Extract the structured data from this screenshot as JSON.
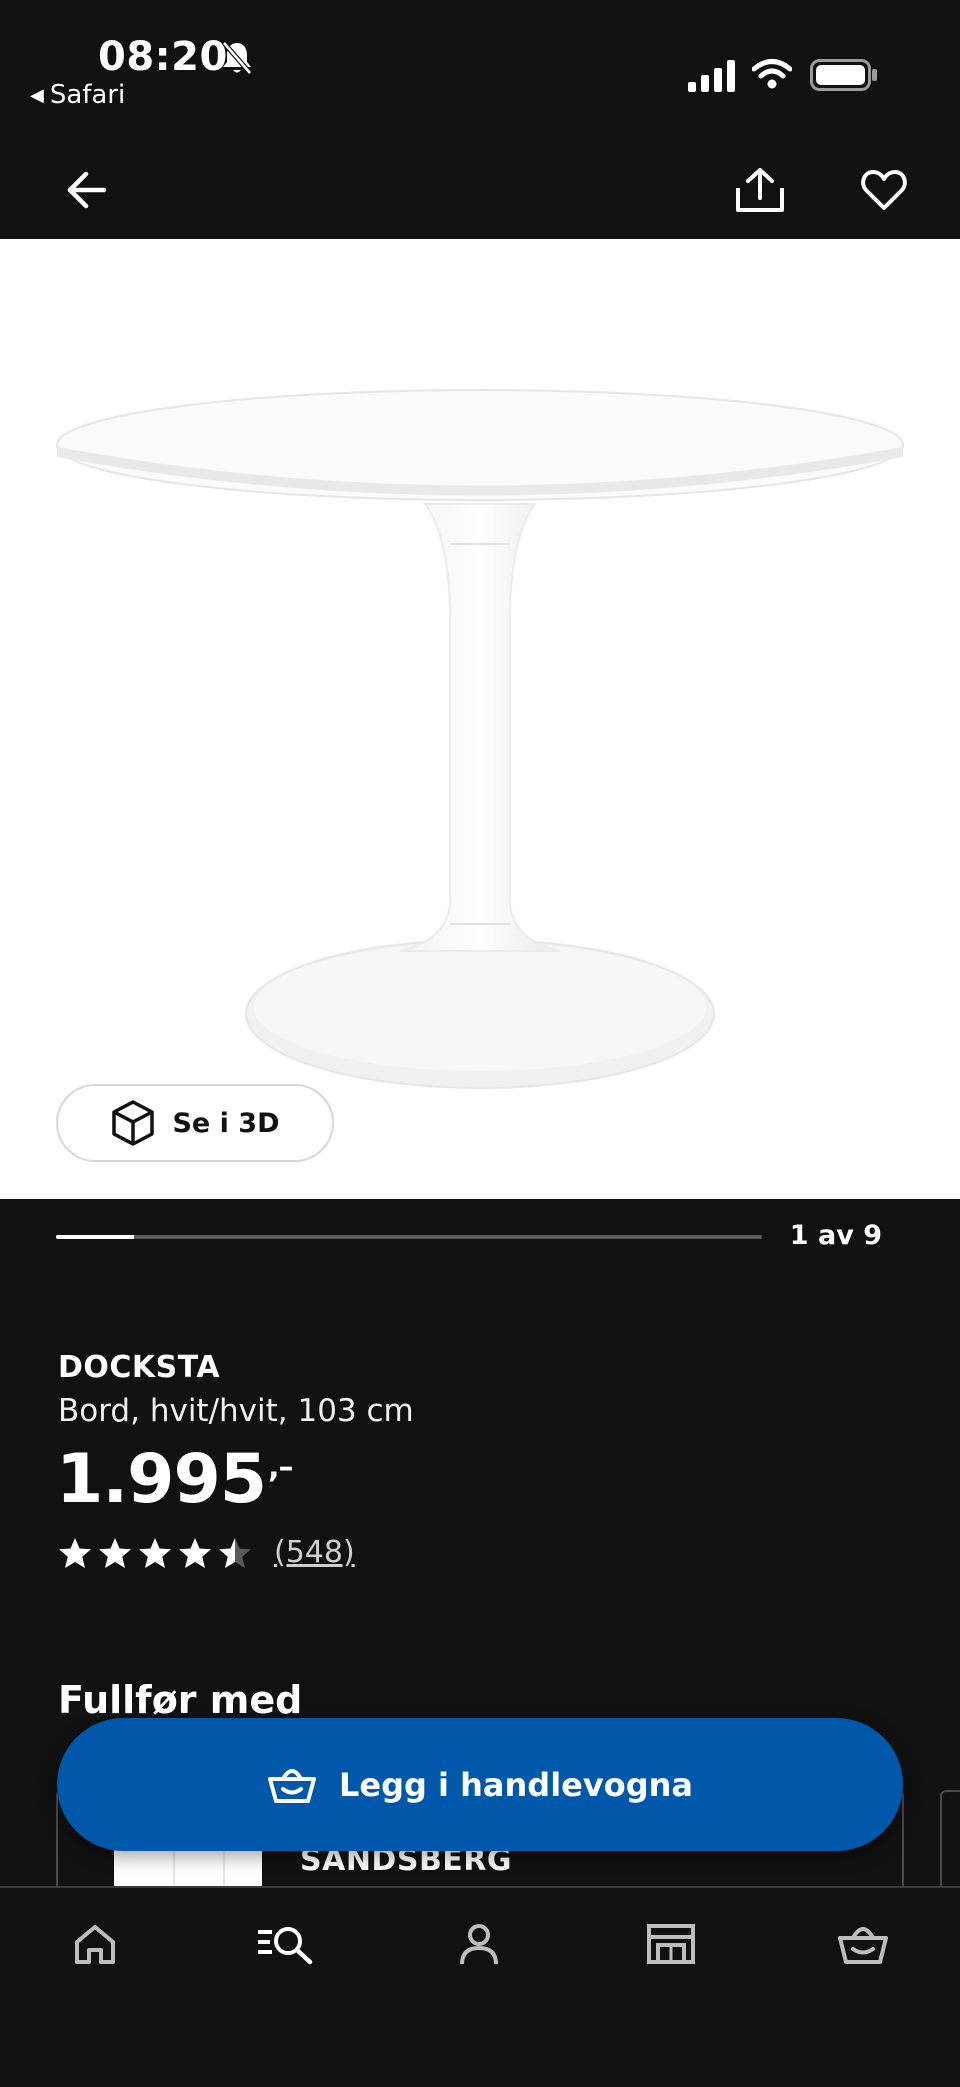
{
  "status_bar": {
    "time": "08:20",
    "back_app": "Safari",
    "icons": [
      "bell-muted-icon",
      "signal-icon",
      "wifi-icon",
      "battery-icon"
    ]
  },
  "header": {
    "icons": [
      "back-arrow-icon",
      "share-icon",
      "heart-icon"
    ]
  },
  "gallery": {
    "view_3d_label": "Se i 3D",
    "counter": "1 av 9",
    "progress": 0.11
  },
  "product": {
    "name": "DOCKSTA",
    "description": "Bord, hvit/hvit, 103 cm",
    "price_main": "1.995",
    "price_suffix": ",–",
    "rating": 4.5,
    "review_count": "(548)"
  },
  "complete_with": {
    "title": "Fullfør med",
    "first_item_name": "SANDSBERG"
  },
  "cta": {
    "label": "Legg i handlevogna",
    "color": "#0058ab"
  },
  "bottom_nav": {
    "items": [
      "home-icon",
      "search-icon",
      "profile-icon",
      "store-icon",
      "cart-icon"
    ]
  }
}
